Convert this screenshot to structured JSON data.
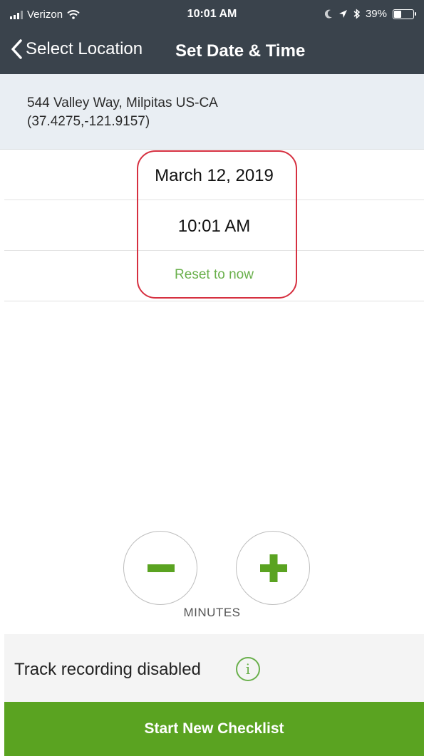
{
  "status_bar": {
    "carrier": "Verizon",
    "time": "10:01 AM",
    "battery_percent": "39%",
    "battery_level": 0.39
  },
  "nav": {
    "back_label": "Select Location",
    "title": "Set Date & Time"
  },
  "location": {
    "address": "544 Valley Way, Milpitas US-CA",
    "coordinates": "(37.4275,-121.9157)"
  },
  "datetime": {
    "date": "March 12, 2019",
    "time": "10:01 AM",
    "reset_label": "Reset to now"
  },
  "stepper": {
    "unit_label": "MINUTES",
    "decrement_icon": "minus-icon",
    "increment_icon": "plus-icon"
  },
  "track": {
    "label": "Track recording disabled",
    "info_glyph": "i"
  },
  "cta": {
    "label": "Start New Checklist"
  },
  "colors": {
    "header_bg": "#3a434c",
    "accent_green": "#5aa321",
    "highlight_ring": "#d63040"
  }
}
